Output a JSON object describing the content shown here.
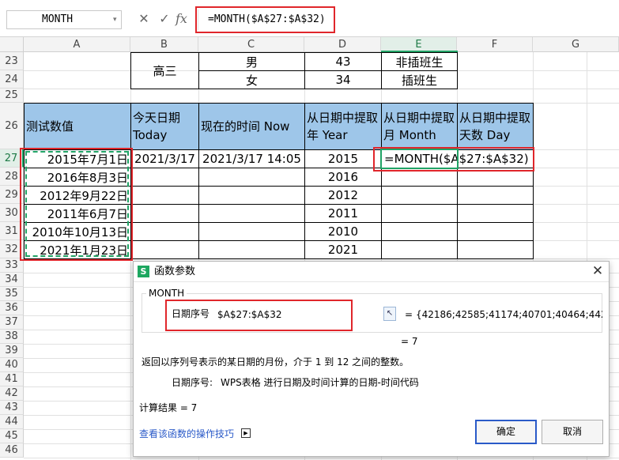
{
  "formula_bar": {
    "name_box": "MONTH",
    "cancel_icon": "✕",
    "confirm_icon": "✓",
    "fx_label": "fx",
    "formula": "=MONTH($A$27:$A$32)"
  },
  "columns": [
    "A",
    "B",
    "C",
    "D",
    "E",
    "F",
    "G"
  ],
  "active_column": "E",
  "rows": [
    "23",
    "24",
    "25",
    "26",
    "27",
    "28",
    "29",
    "30",
    "31",
    "32",
    "33",
    "34",
    "35",
    "36",
    "37",
    "38",
    "39",
    "40",
    "41",
    "42",
    "43",
    "44",
    "45",
    "46"
  ],
  "active_row": "27",
  "top_table": {
    "b_label": "高三",
    "rows": [
      {
        "c": "男",
        "d": "43",
        "e": "非插班生"
      },
      {
        "c": "女",
        "d": "34",
        "e": "插班生"
      }
    ]
  },
  "main_table": {
    "headers": {
      "a": "测试数值",
      "b": "今天日期 Today",
      "c": "现在的时间 Now",
      "d": "从日期中提取年 Year",
      "e": "从日期中提取月 Month",
      "f": "从日期中提取天数 Day"
    },
    "dates": [
      "2015年7月1日",
      "2016年8月3日",
      "2012年9月22日",
      "2011年6月7日",
      "2010年10月13日",
      "2021年1月23日"
    ],
    "today": "2021/3/17",
    "now": "2021/3/17 14:05",
    "years": [
      "2015",
      "2016",
      "2012",
      "2011",
      "2010",
      "2021"
    ],
    "editing_formula": "=MONTH($A$27:$A$32)"
  },
  "dialog": {
    "logo": "S",
    "title": "函数参数",
    "close_icon": "✕",
    "function_name": "MONTH",
    "arg_label": "日期序号",
    "arg_value": "$A$27:$A$32",
    "arg_equals": "=",
    "arg_result": "{42186;42585;41174;40701;40464;442...",
    "result_line": "=  7",
    "description": "返回以序列号表示的某日期的月份，介于 1 到 12 之间的整数。",
    "param_name": "日期序号:",
    "param_desc": "WPS表格 进行日期及时间计算的日期-时间代码",
    "calc_result": "计算结果  =  7",
    "help_link": "查看该函数的操作技巧",
    "ok_label": "确定",
    "cancel_label": "取消"
  },
  "colors": {
    "header_fill": "#9ec6e9",
    "highlight_red": "#e0262b",
    "active_green": "#21a366",
    "link_blue": "#2a5ac8"
  }
}
